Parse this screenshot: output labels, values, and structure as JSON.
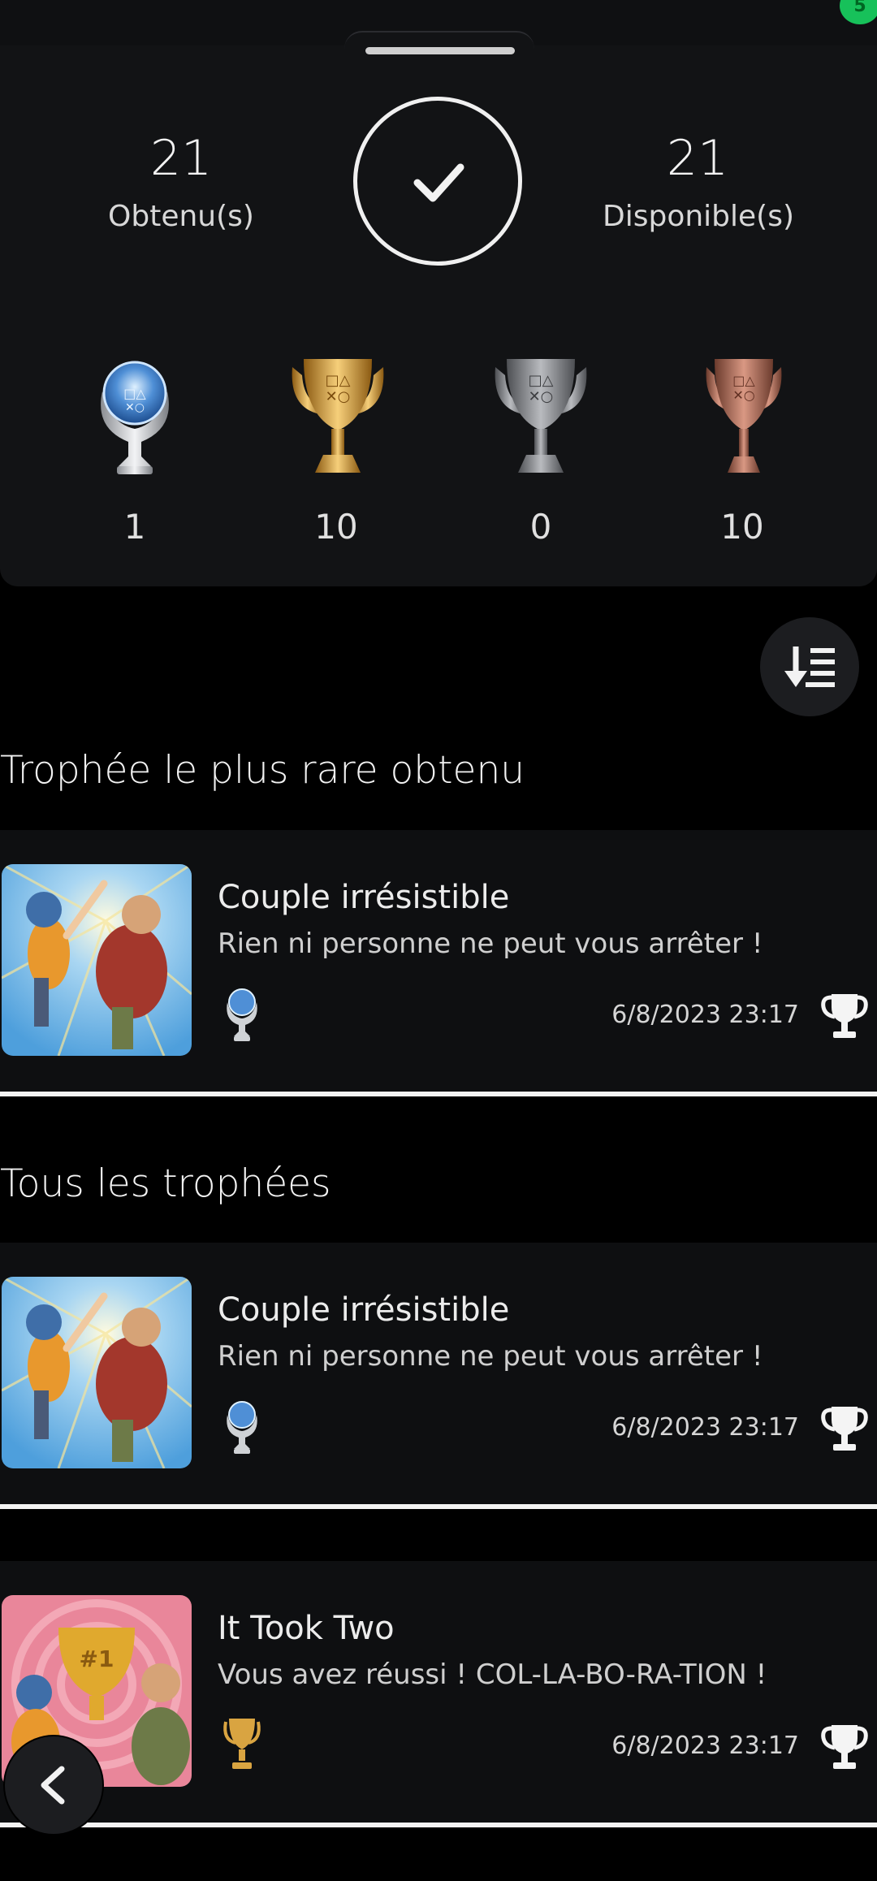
{
  "status": {
    "notification_count": "5"
  },
  "summary": {
    "earned_count": "21",
    "earned_label": "Obtenu(s)",
    "available_count": "21",
    "available_label": "Disponible(s)",
    "completion_fraction": 1.0
  },
  "trophy_counts": {
    "platinum": "1",
    "gold": "10",
    "silver": "0",
    "bronze": "10"
  },
  "colors": {
    "platinum": "#7fb2e6",
    "gold": "#d9a441",
    "silver": "#a0a2a6",
    "bronze": "#b46f5c",
    "badge": "#17c15a"
  },
  "sections": {
    "rarest_title": "Trophée le plus rare obtenu",
    "all_title": "Tous les trophées"
  },
  "rarest": {
    "name": "Couple irrésistible",
    "description": "Rien ni personne ne peut vous arrêter !",
    "date": "6/8/2023  23:17",
    "grade": "platinum"
  },
  "trophies": [
    {
      "name": "Couple irrésistible",
      "description": "Rien ni personne ne peut vous arrêter !",
      "date": "6/8/2023  23:17",
      "grade": "platinum"
    },
    {
      "name": "It Took Two",
      "description": "Vous avez réussi ! COL-LA-BO-RA-TION !",
      "date": "6/8/2023  23:17",
      "grade": "gold",
      "thumb_text": "#1"
    }
  ],
  "icons": {
    "sort": "sort-descending-icon",
    "back": "chevron-left-icon",
    "check": "check-icon",
    "earned": "trophy-outline-icon"
  }
}
